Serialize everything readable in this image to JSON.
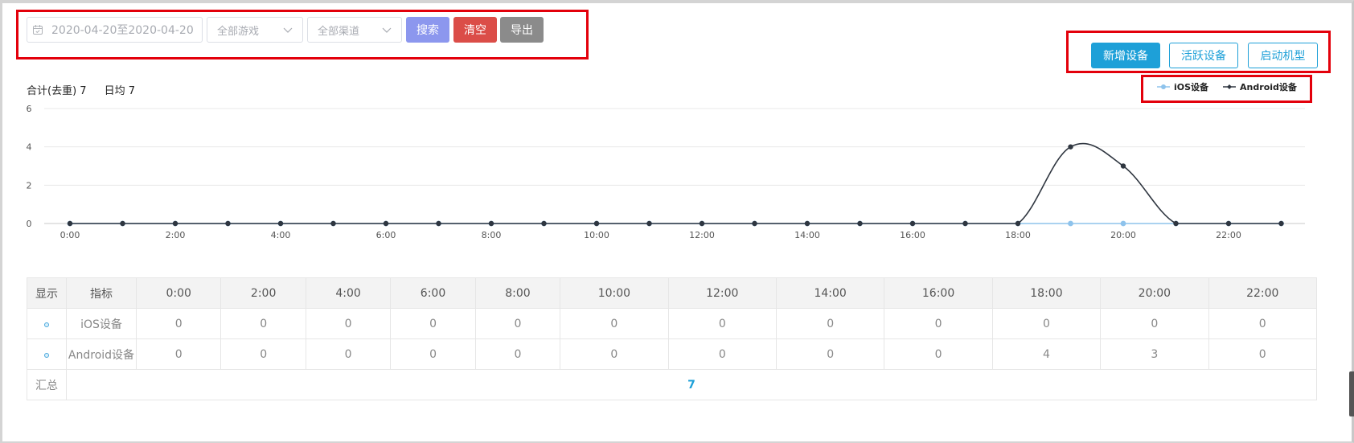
{
  "filters": {
    "date_range": "2020-04-20至2020-04-20",
    "game_select": "全部游戏",
    "channel_select": "全部渠道",
    "search_label": "搜索",
    "clear_label": "清空",
    "export_label": "导出"
  },
  "tabs": [
    {
      "label": "新增设备",
      "active": true
    },
    {
      "label": "活跃设备",
      "active": false
    },
    {
      "label": "启动机型",
      "active": false
    }
  ],
  "summary": {
    "total_label": "合计(去重) 7",
    "daily_avg_label": "日均 7"
  },
  "legend": {
    "ios": "iOS设备",
    "android": "Android设备"
  },
  "colors": {
    "ios": "#8ec3ec",
    "android": "#2f3640",
    "accent": "#1ea0d8"
  },
  "chart_data": {
    "type": "line",
    "x": [
      "0:00",
      "1:00",
      "2:00",
      "3:00",
      "4:00",
      "5:00",
      "6:00",
      "7:00",
      "8:00",
      "9:00",
      "10:00",
      "11:00",
      "12:00",
      "13:00",
      "14:00",
      "15:00",
      "16:00",
      "17:00",
      "18:00",
      "19:00",
      "20:00",
      "21:00",
      "22:00",
      "23:00"
    ],
    "x_tick_labels": [
      "0:00",
      "2:00",
      "4:00",
      "6:00",
      "8:00",
      "10:00",
      "12:00",
      "14:00",
      "16:00",
      "18:00",
      "20:00",
      "22:00"
    ],
    "y_ticks": [
      "0",
      "2",
      "4",
      "6"
    ],
    "ylim": [
      0,
      6
    ],
    "grid": true,
    "legend_position": "top-right",
    "series": [
      {
        "name": "iOS设备",
        "values": [
          0,
          0,
          0,
          0,
          0,
          0,
          0,
          0,
          0,
          0,
          0,
          0,
          0,
          0,
          0,
          0,
          0,
          0,
          0,
          0,
          0,
          0,
          0,
          0
        ]
      },
      {
        "name": "Android设备",
        "values": [
          0,
          0,
          0,
          0,
          0,
          0,
          0,
          0,
          0,
          0,
          0,
          0,
          0,
          0,
          0,
          0,
          0,
          0,
          0,
          4,
          3,
          0,
          0,
          0
        ]
      }
    ]
  },
  "table": {
    "headers": [
      "显示",
      "指标",
      "0:00",
      "2:00",
      "4:00",
      "6:00",
      "8:00",
      "10:00",
      "12:00",
      "14:00",
      "16:00",
      "18:00",
      "20:00",
      "22:00"
    ],
    "rows": [
      {
        "name": "iOS设备",
        "values": [
          "0",
          "0",
          "0",
          "0",
          "0",
          "0",
          "0",
          "0",
          "0",
          "0",
          "0",
          "0"
        ]
      },
      {
        "name": "Android设备",
        "values": [
          "0",
          "0",
          "0",
          "0",
          "0",
          "0",
          "0",
          "0",
          "0",
          "4",
          "3",
          "0"
        ]
      }
    ],
    "total_label": "汇总",
    "total_value": "7"
  }
}
